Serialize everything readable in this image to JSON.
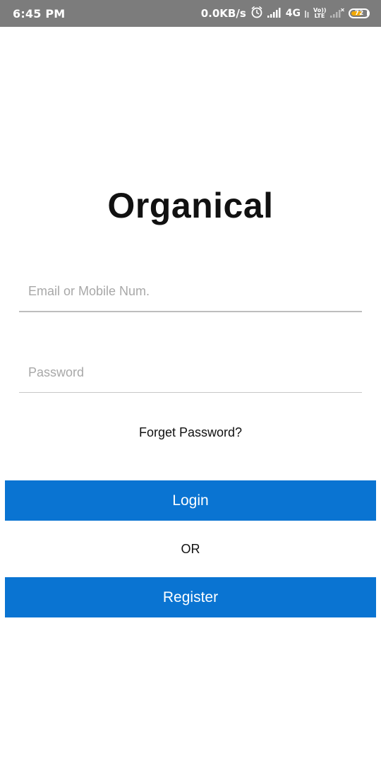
{
  "status_bar": {
    "time": "6:45 PM",
    "net_speed": "0.0KB/s",
    "network_type": "4G",
    "volte_top": "Vo))",
    "volte_bottom": "LTE",
    "battery_level": "72",
    "battery_fraction": 0.72,
    "icons": [
      "alarm-icon",
      "signal-icon",
      "signal-weak-icon",
      "battery-icon"
    ],
    "battery_color": "#f2a900"
  },
  "app": {
    "title": "Organical"
  },
  "login_form": {
    "email_placeholder": "Email or Mobile Num.",
    "email_value": "",
    "password_placeholder": "Password",
    "password_value": "",
    "forget_label": "Forget Password?",
    "login_label": "Login",
    "or_label": "OR",
    "register_label": "Register"
  },
  "colors": {
    "primary_button": "#0a74d2",
    "status_bar": "#7c7c7c"
  }
}
